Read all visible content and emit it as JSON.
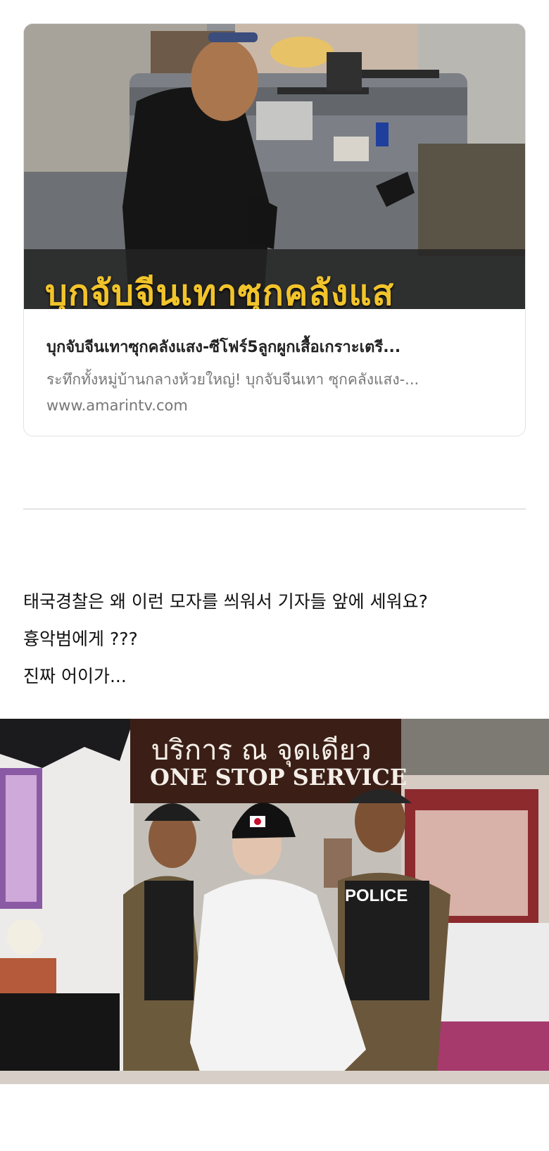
{
  "link_card": {
    "image_caption": "บุกจับจีนเทาซุกคลังแส",
    "title": "บุกจับจีนเทาซุกคลังแสง-ซีโฟร์5ลูกผูกเสื้อเกราะเตรี...",
    "description": "ระทึกทั้งหมู่บ้านกลางห้วยใหญ่! บุกจับจีนเทา ซุกคลังแสง-...",
    "url": "www.amarintv.com"
  },
  "post": {
    "lines": [
      "태국경찰은 왜 이런 모자를 씌워서 기자들 앞에 세워요?",
      "흉악범에게 ???",
      "진짜 어이가..."
    ]
  },
  "photo": {
    "sign_thai": "บริการ ณ จุดเดียว",
    "sign_english": "ONE STOP SERVICE",
    "vest_text": "POLICE"
  },
  "colors": {
    "caption_yellow": "#f2c42b",
    "text_primary": "#222222",
    "text_secondary": "#777777",
    "card_border": "#e2e2e2"
  }
}
